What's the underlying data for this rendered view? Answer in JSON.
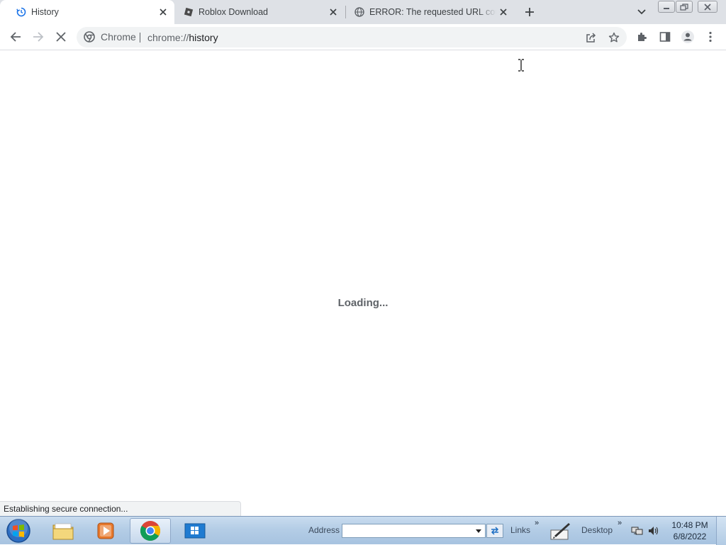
{
  "browser": {
    "tabs": [
      {
        "title": "History",
        "favicon": "history-icon",
        "active": true
      },
      {
        "title": "Roblox Download",
        "favicon": "roblox-icon",
        "active": false
      },
      {
        "title": "ERROR: The requested URL could not be retrieved",
        "favicon": "globe-icon",
        "active": false
      }
    ],
    "omnibox": {
      "chip_label": "Chrome",
      "url_scheme": "chrome://",
      "url_host": "history"
    }
  },
  "page": {
    "loading_text": "Loading...",
    "status_text": "Establishing secure connection..."
  },
  "taskbar": {
    "address_label": "Address",
    "address_value": "",
    "links_label": "Links",
    "desktop_label": "Desktop",
    "time": "10:48 PM",
    "date": "6/8/2022"
  },
  "colors": {
    "tabstrip_bg": "#dee1e6",
    "omnibox_bg": "#f1f3f4",
    "chrome_blue": "#1a73e8",
    "taskbar_top": "#c9dcef",
    "taskbar_bottom": "#a7c3e0"
  }
}
